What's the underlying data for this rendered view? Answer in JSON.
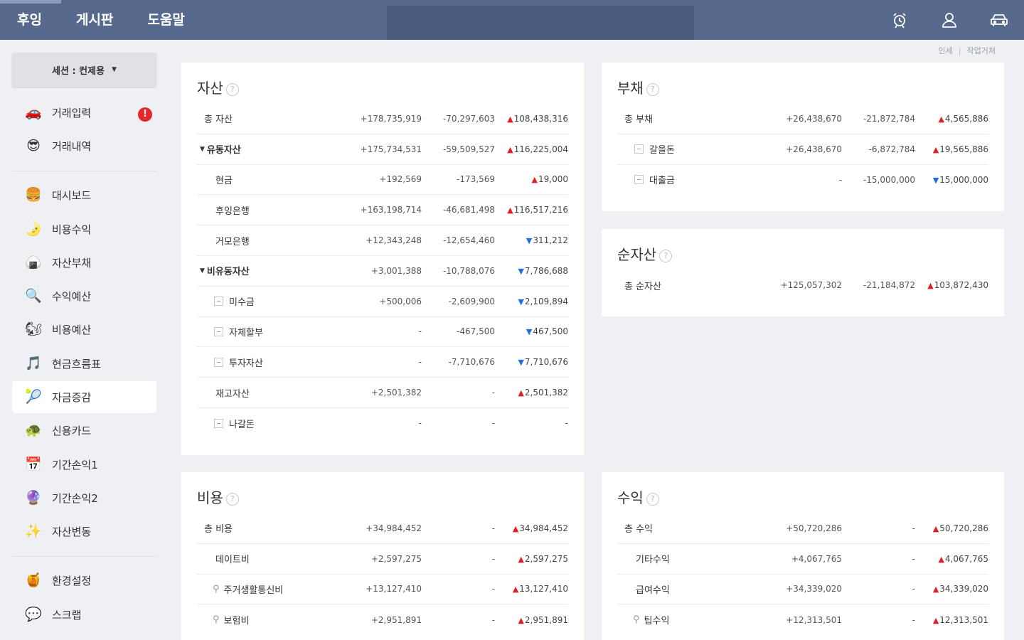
{
  "topnav": {
    "items": [
      "후잉",
      "게시판",
      "도움말"
    ],
    "icons": [
      "alarm-icon",
      "user-icon",
      "car-icon"
    ]
  },
  "breadcrumb": [
    "인세",
    "작업거쳐"
  ],
  "session": {
    "label": "세션 : 컨제용"
  },
  "sidebar": {
    "group1": [
      {
        "label": "거래입력",
        "emoji": "🚗",
        "alert": "!"
      },
      {
        "label": "거래내역",
        "emoji": "😎"
      }
    ],
    "group2": [
      {
        "label": "대시보드",
        "emoji": "🍔"
      },
      {
        "label": "비용수익",
        "emoji": "🌛"
      },
      {
        "label": "자산부채",
        "emoji": "🍙"
      },
      {
        "label": "수익예산",
        "emoji": "🔍"
      },
      {
        "label": "비용예산",
        "emoji": "🐿"
      },
      {
        "label": "현금흐름표",
        "emoji": "🎵"
      },
      {
        "label": "자금증감",
        "emoji": "🎾"
      },
      {
        "label": "신용카드",
        "emoji": "🐢"
      },
      {
        "label": "기간손익1",
        "emoji": "📅"
      },
      {
        "label": "기간손익2",
        "emoji": "🔮"
      },
      {
        "label": "자산변동",
        "emoji": "✨"
      }
    ],
    "group3": [
      {
        "label": "환경설정",
        "emoji": "🍯"
      },
      {
        "label": "스크랩",
        "emoji": "💬"
      }
    ]
  },
  "assets": {
    "title": "자산",
    "rows": [
      {
        "name": "총 자산",
        "type": "total",
        "a": "+178,735,919",
        "b": "-70,297,603",
        "dir": "up",
        "diff": "108,438,316"
      },
      {
        "name": "유동자산",
        "type": "group",
        "a": "+175,734,531",
        "b": "-59,509,527",
        "dir": "up",
        "diff": "116,225,004"
      },
      {
        "name": "현금",
        "type": "sub",
        "a": "+192,569",
        "b": "-173,569",
        "dir": "up",
        "diff": "19,000"
      },
      {
        "name": "후잉은행",
        "type": "sub",
        "a": "+163,198,714",
        "b": "-46,681,498",
        "dir": "up",
        "diff": "116,517,216"
      },
      {
        "name": "거모은행",
        "type": "sub",
        "a": "+12,343,248",
        "b": "-12,654,460",
        "dir": "down",
        "diff": "311,212"
      },
      {
        "name": "비유동자산",
        "type": "group",
        "a": "+3,001,388",
        "b": "-10,788,076",
        "dir": "down",
        "diff": "7,786,688"
      },
      {
        "name": "미수금",
        "type": "box",
        "a": "+500,006",
        "b": "-2,609,900",
        "dir": "down",
        "diff": "2,109,894"
      },
      {
        "name": "자체할부",
        "type": "box",
        "a": "-",
        "b": "-467,500",
        "dir": "down",
        "diff": "467,500"
      },
      {
        "name": "투자자산",
        "type": "box",
        "a": "-",
        "b": "-7,710,676",
        "dir": "down",
        "diff": "7,710,676"
      },
      {
        "name": "재고자산",
        "type": "sub",
        "a": "+2,501,382",
        "b": "-",
        "dir": "up",
        "diff": "2,501,382"
      },
      {
        "name": "나갈돈",
        "type": "box",
        "a": "-",
        "b": "-",
        "dir": "none",
        "diff": "-"
      }
    ]
  },
  "liabilities": {
    "title": "부채",
    "rows": [
      {
        "name": "총 부채",
        "type": "total",
        "a": "+26,438,670",
        "b": "-21,872,784",
        "dir": "up",
        "diff": "4,565,886"
      },
      {
        "name": "갈을돈",
        "type": "box",
        "a": "+26,438,670",
        "b": "-6,872,784",
        "dir": "up",
        "diff": "19,565,886"
      },
      {
        "name": "대출금",
        "type": "box",
        "a": "-",
        "b": "-15,000,000",
        "dir": "down",
        "diff": "15,000,000"
      }
    ]
  },
  "net_assets": {
    "title": "순자산",
    "rows": [
      {
        "name": "총 순자산",
        "type": "total",
        "a": "+125,057,302",
        "b": "-21,184,872",
        "dir": "up",
        "diff": "103,872,430"
      }
    ]
  },
  "expenses": {
    "title": "비용",
    "rows": [
      {
        "name": "총 비용",
        "type": "total",
        "a": "+34,984,452",
        "b": "-",
        "dir": "up",
        "diff": "34,984,452"
      },
      {
        "name": "데이트비",
        "type": "sub",
        "a": "+2,597,275",
        "b": "-",
        "dir": "up",
        "diff": "2,597,275"
      },
      {
        "name": "주거생활통신비",
        "type": "key",
        "a": "+13,127,410",
        "b": "-",
        "dir": "up",
        "diff": "13,127,410"
      },
      {
        "name": "보험비",
        "type": "key",
        "a": "+2,951,891",
        "b": "-",
        "dir": "up",
        "diff": "2,951,891"
      }
    ]
  },
  "income": {
    "title": "수익",
    "rows": [
      {
        "name": "총 수익",
        "type": "total",
        "a": "+50,720,286",
        "b": "-",
        "dir": "up",
        "diff": "50,720,286"
      },
      {
        "name": "기타수익",
        "type": "sub",
        "a": "+4,067,765",
        "b": "-",
        "dir": "up",
        "diff": "4,067,765"
      },
      {
        "name": "급여수익",
        "type": "sub",
        "a": "+34,339,020",
        "b": "-",
        "dir": "up",
        "diff": "34,339,020"
      },
      {
        "name": "팁수익",
        "type": "key",
        "a": "+12,313,501",
        "b": "-",
        "dir": "up",
        "diff": "12,313,501"
      }
    ]
  },
  "colors": {
    "topbar": "#56698c",
    "up": "#e21d24",
    "down": "#1f6fe0",
    "alert": "#e5262a"
  }
}
